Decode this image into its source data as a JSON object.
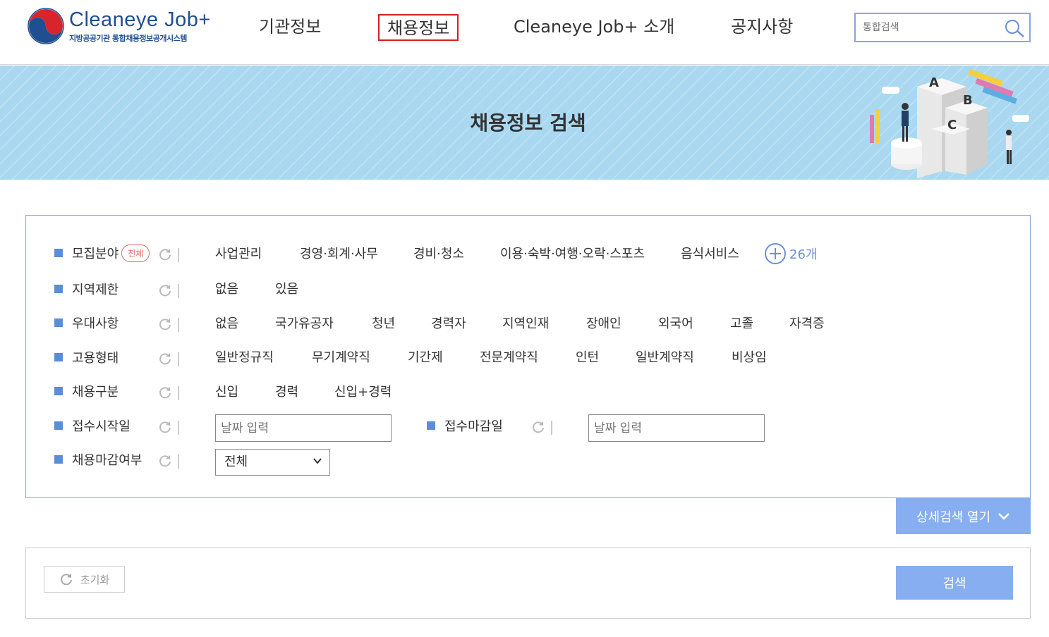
{
  "header": {
    "logo_title": "Cleaneye Job+",
    "logo_sub": "지방공공기관 통합채용정보공개시스템",
    "nav": [
      "기관정보",
      "채용정보",
      "Cleaneye Job+ 소개",
      "공지사항"
    ],
    "search_placeholder": "통합검색"
  },
  "banner": {
    "title": "채용정보 검색"
  },
  "filters": {
    "field": {
      "label": "모집분야",
      "badge": "전체",
      "options": [
        "사업관리",
        "경영·회계·사무",
        "경비·청소",
        "이용·숙박·여행·오락·스포츠",
        "음식서비스"
      ],
      "more": "26개"
    },
    "region": {
      "label": "지역제한",
      "options": [
        "없음",
        "있음"
      ]
    },
    "preference": {
      "label": "우대사항",
      "options": [
        "없음",
        "국가유공자",
        "청년",
        "경력자",
        "지역인재",
        "장애인",
        "외국어",
        "고졸",
        "자격증"
      ]
    },
    "employment": {
      "label": "고용형태",
      "options": [
        "일반정규직",
        "무기계약직",
        "기간제",
        "전문계약직",
        "인턴",
        "일반계약직",
        "비상임"
      ]
    },
    "hiring": {
      "label": "채용구분",
      "options": [
        "신입",
        "경력",
        "신입+경력"
      ]
    },
    "start_date": {
      "label": "접수시작일",
      "placeholder": "날짜 입력"
    },
    "end_date": {
      "label": "접수마감일",
      "placeholder": "날짜 입력"
    },
    "closed": {
      "label": "채용마감여부",
      "value": "전체"
    }
  },
  "buttons": {
    "detail_open": "상세검색 열기",
    "reset": "초기화",
    "search": "검색"
  },
  "colors": {
    "accent": "#86aef0",
    "bullet": "#5b8ed8",
    "active_border": "#d81e1e",
    "banner": "#a9d8f0"
  }
}
